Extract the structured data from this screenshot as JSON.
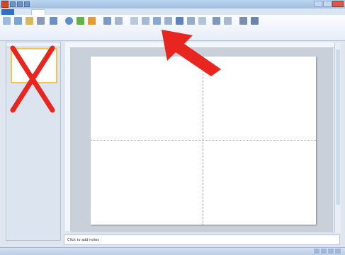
{
  "colors": {
    "accent_red": "#e8261f",
    "file_tab_blue": "#2f6fc6",
    "selected_thumb_border": "#f3c64a"
  },
  "icons": {
    "arrow": "red-arrow-icon",
    "cross": "red-x-icon"
  },
  "notes": {
    "placeholder": "Click to add notes"
  }
}
